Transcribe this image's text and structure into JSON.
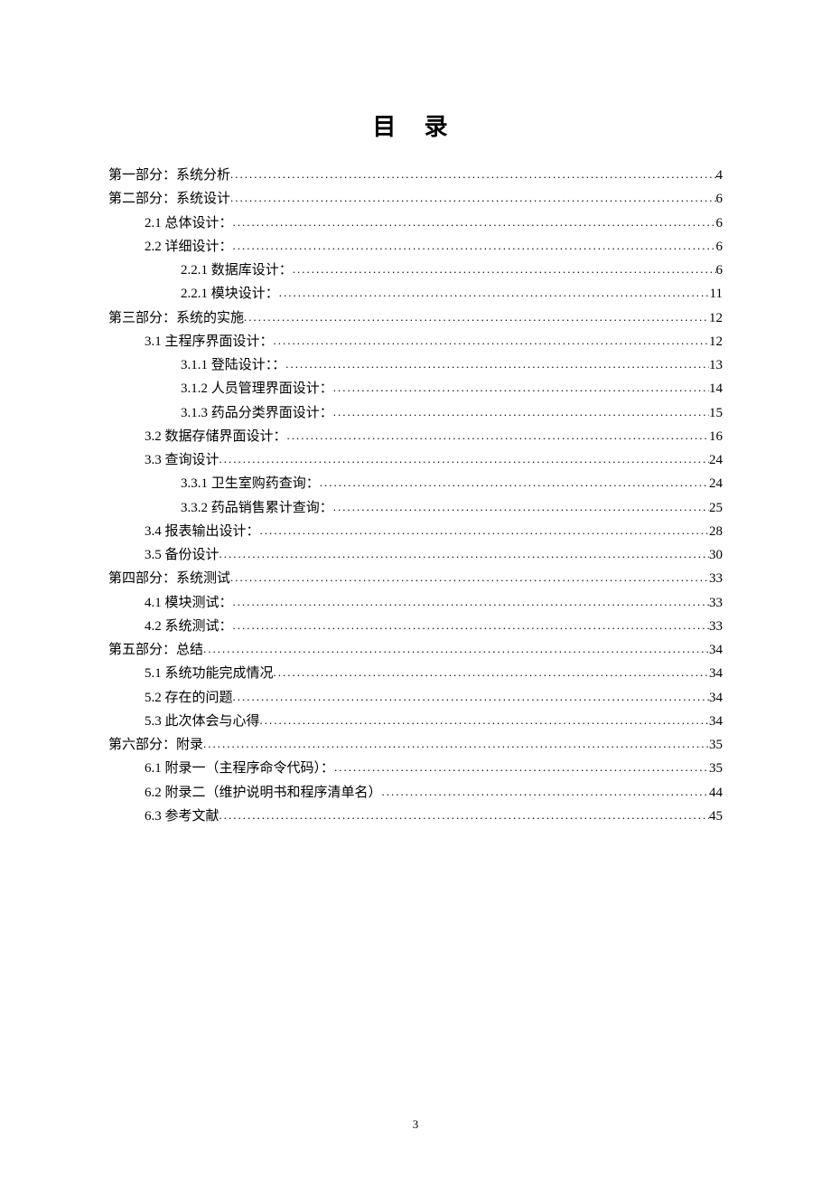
{
  "title": "目 录",
  "page_number": "3",
  "toc": [
    {
      "text": "第一部分：系统分析",
      "page": "4",
      "indent": 0
    },
    {
      "text": "第二部分：系统设计",
      "page": "6",
      "indent": 0
    },
    {
      "text": "2.1 总体设计：",
      "page": "6",
      "indent": 1
    },
    {
      "text": "2.2 详细设计：",
      "page": "6",
      "indent": 1
    },
    {
      "text": "2.2.1 数据库设计：",
      "page": "6",
      "indent": 2
    },
    {
      "text": "2.2.1 模块设计：",
      "page": "11",
      "indent": 2
    },
    {
      "text": "第三部分：系统的实施",
      "page": "12",
      "indent": 0
    },
    {
      "text": "3.1 主程序界面设计：",
      "page": "12",
      "indent": 1
    },
    {
      "text": "3.1.1 登陆设计：：",
      "page": "13",
      "indent": 2
    },
    {
      "text": "3.1.2 人员管理界面设计：",
      "page": "14",
      "indent": 2
    },
    {
      "text": "3.1.3 药品分类界面设计：",
      "page": "15",
      "indent": 2
    },
    {
      "text": "3.2 数据存储界面设计：",
      "page": "16",
      "indent": 1
    },
    {
      "text": "3.3 查询设计",
      "page": "24",
      "indent": 1
    },
    {
      "text": "3.3.1 卫生室购药查询：",
      "page": "24",
      "indent": 2
    },
    {
      "text": "3.3.2 药品销售累计查询：",
      "page": "25",
      "indent": 2
    },
    {
      "text": "3.4 报表输出设计：",
      "page": "28",
      "indent": 1
    },
    {
      "text": "3.5 备份设计",
      "page": "30",
      "indent": 1
    },
    {
      "text": "第四部分：系统测试",
      "page": "33",
      "indent": 0
    },
    {
      "text": "4.1 模块测试：",
      "page": "33",
      "indent": 1
    },
    {
      "text": "4.2 系统测试：",
      "page": "33",
      "indent": 1
    },
    {
      "text": "第五部分：总结",
      "page": "34",
      "indent": 0
    },
    {
      "text": "5.1 系统功能完成情况",
      "page": "34",
      "indent": 1
    },
    {
      "text": "5.2 存在的问题",
      "page": "34",
      "indent": 1
    },
    {
      "text": "5.3 此次体会与心得",
      "page": "34",
      "indent": 1
    },
    {
      "text": "第六部分：附录",
      "page": "35",
      "indent": 0
    },
    {
      "text": "6.1 附录一（主程序命令代码）：",
      "page": "35",
      "indent": 1
    },
    {
      "text": "6.2 附录二（维护说明书和程序清单名）",
      "page": "44",
      "indent": 1
    },
    {
      "text": "6.3 参考文献",
      "page": "45",
      "indent": 1
    }
  ]
}
